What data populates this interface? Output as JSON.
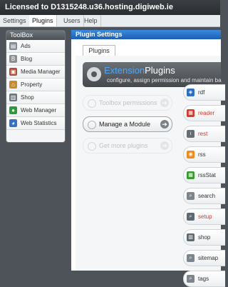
{
  "header": {
    "title": "Licensed to D1315248.u36.hosting.digiweb.ie"
  },
  "menu": [
    "Settings",
    "Plugins",
    "Users",
    "Help"
  ],
  "toolbox": {
    "title": "ToolBox",
    "items": [
      {
        "label": "Ads",
        "icon": "ads-icon",
        "color": "#7f8a94"
      },
      {
        "label": "Blog",
        "icon": "blog-icon",
        "color": "#8a8f94"
      },
      {
        "label": "Media Manager",
        "icon": "media-manager-icon",
        "color": "#b04c3a"
      },
      {
        "label": "Property",
        "icon": "property-icon",
        "color": "#c98a2a"
      },
      {
        "label": "Shop",
        "icon": "shop-icon",
        "color": "#6d7780"
      },
      {
        "label": "Web Manager",
        "icon": "web-manager-icon",
        "color": "#2f9a3d"
      },
      {
        "label": "Web Statistics",
        "icon": "web-statistics-icon",
        "color": "#3a6fc7"
      }
    ]
  },
  "panel": {
    "title": "Plugin Settings",
    "tab": "Plugins",
    "banner": {
      "title_left": "Extension",
      "title_right": "Plugins",
      "subtitle": "configure, assign permission and maintain ba"
    },
    "actions": [
      {
        "label": "Toolbox permissions",
        "state": "dim"
      },
      {
        "label": "Manage a Module",
        "state": "active"
      },
      {
        "label": "Get more plugins",
        "state": "dim"
      }
    ],
    "plugins": [
      {
        "label": "rdf",
        "icon": "rdf-icon",
        "color": "#2f6fc0",
        "text_color": "#333333"
      },
      {
        "label": "reader",
        "icon": "reader-icon",
        "color": "#d33b2f",
        "text_color": "#d33b2f"
      },
      {
        "label": "rest",
        "icon": "rest-icon",
        "color": "#666d73",
        "text_color": "#d33b2f"
      },
      {
        "label": "rss",
        "icon": "rss-icon",
        "color": "#f08a1a",
        "text_color": "#333333"
      },
      {
        "label": "rssStat",
        "icon": "rssstat-icon",
        "color": "#3b9a2f",
        "text_color": "#333333"
      },
      {
        "label": "search",
        "icon": "search-icon",
        "color": "#7c858c",
        "text_color": "#333333"
      },
      {
        "label": "setup",
        "icon": "setup-icon",
        "color": "#5e6870",
        "text_color": "#d33b2f"
      },
      {
        "label": "shop",
        "icon": "shop-cart-icon",
        "color": "#5e6870",
        "text_color": "#333333"
      },
      {
        "label": "sitemap",
        "icon": "sitemap-icon",
        "color": "#7c858c",
        "text_color": "#333333"
      },
      {
        "label": "tags",
        "icon": "tags-icon",
        "color": "#7c858c",
        "text_color": "#333333"
      }
    ]
  }
}
